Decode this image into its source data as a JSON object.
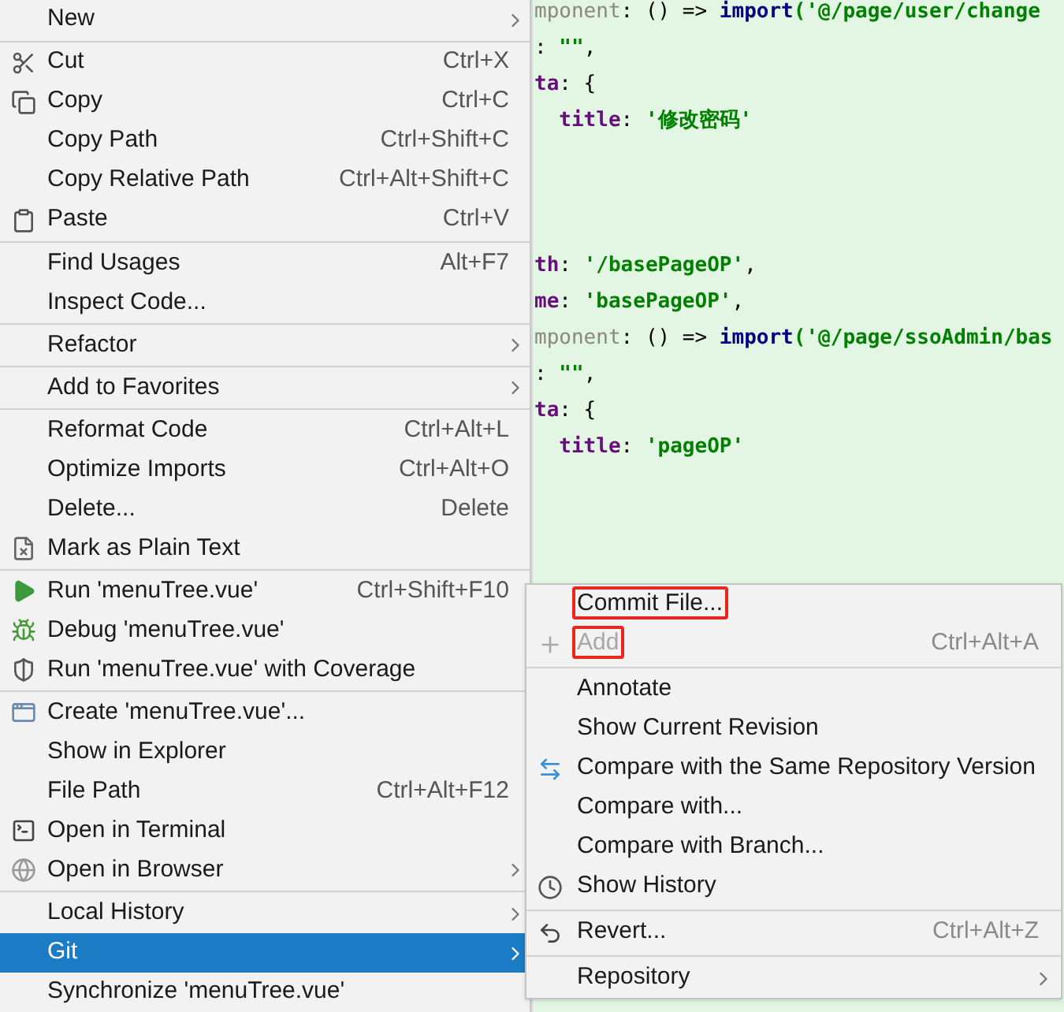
{
  "editor": {
    "code_blocks": [
      {
        "lines": [
          {
            "tokens": [
              {
                "text": "mponent",
                "kind": "dim"
              },
              {
                "text": ": () => ",
                "kind": "plain"
              },
              {
                "text": "import",
                "kind": "keyword"
              },
              {
                "text": "('@/page/user/change",
                "kind": "string"
              }
            ]
          },
          {
            "tokens": [
              {
                "text": ": ",
                "kind": "plain"
              },
              {
                "text": "\"\"",
                "kind": "string"
              },
              {
                "text": ",",
                "kind": "plain"
              }
            ]
          },
          {
            "tokens": [
              {
                "text": "ta",
                "kind": "key"
              },
              {
                "text": ": {",
                "kind": "plain"
              }
            ]
          },
          {
            "tokens": [
              {
                "text": "  title",
                "kind": "key"
              },
              {
                "text": ": ",
                "kind": "plain"
              },
              {
                "text": "'修改密码'",
                "kind": "string"
              }
            ]
          }
        ]
      },
      {
        "lines": [
          {
            "tokens": [
              {
                "text": "th",
                "kind": "key"
              },
              {
                "text": ": ",
                "kind": "plain"
              },
              {
                "text": "'/basePageOP'",
                "kind": "string"
              },
              {
                "text": ",",
                "kind": "plain"
              }
            ]
          },
          {
            "tokens": [
              {
                "text": "me",
                "kind": "key"
              },
              {
                "text": ": ",
                "kind": "plain"
              },
              {
                "text": "'basePageOP'",
                "kind": "string"
              },
              {
                "text": ",",
                "kind": "plain"
              }
            ]
          },
          {
            "tokens": [
              {
                "text": "mponent",
                "kind": "dim"
              },
              {
                "text": ": () => ",
                "kind": "plain"
              },
              {
                "text": "import",
                "kind": "keyword"
              },
              {
                "text": "('@/page/ssoAdmin/bas",
                "kind": "string"
              }
            ]
          },
          {
            "tokens": [
              {
                "text": ": ",
                "kind": "plain"
              },
              {
                "text": "\"\"",
                "kind": "string"
              },
              {
                "text": ",",
                "kind": "plain"
              }
            ]
          },
          {
            "tokens": [
              {
                "text": "ta",
                "kind": "key"
              },
              {
                "text": ": {",
                "kind": "plain"
              }
            ]
          },
          {
            "tokens": [
              {
                "text": "  title",
                "kind": "key"
              },
              {
                "text": ": ",
                "kind": "plain"
              },
              {
                "text": "'pageOP'",
                "kind": "string"
              }
            ]
          }
        ]
      }
    ]
  },
  "context_menu": {
    "items": [
      {
        "kind": "item",
        "label": "New",
        "submenu": true,
        "selected": false
      },
      {
        "kind": "separator"
      },
      {
        "kind": "item",
        "label": "Cut",
        "shortcut": "Ctrl+X",
        "selected": false
      },
      {
        "kind": "item",
        "label": "Copy",
        "shortcut": "Ctrl+C",
        "selected": false
      },
      {
        "kind": "item",
        "label": "Copy Path",
        "shortcut": "Ctrl+Shift+C",
        "selected": false
      },
      {
        "kind": "item",
        "label": "Copy Relative Path",
        "shortcut": "Ctrl+Alt+Shift+C",
        "selected": false
      },
      {
        "kind": "item",
        "label": "Paste",
        "shortcut": "Ctrl+V",
        "selected": false
      },
      {
        "kind": "separator"
      },
      {
        "kind": "item",
        "label": "Find Usages",
        "shortcut": "Alt+F7",
        "selected": false
      },
      {
        "kind": "item",
        "label": "Inspect Code...",
        "selected": false
      },
      {
        "kind": "separator"
      },
      {
        "kind": "item",
        "label": "Refactor",
        "submenu": true,
        "selected": false
      },
      {
        "kind": "separator"
      },
      {
        "kind": "item",
        "label": "Add to Favorites",
        "submenu": true,
        "selected": false
      },
      {
        "kind": "separator"
      },
      {
        "kind": "item",
        "label": "Reformat Code",
        "shortcut": "Ctrl+Alt+L",
        "selected": false
      },
      {
        "kind": "item",
        "label": "Optimize Imports",
        "shortcut": "Ctrl+Alt+O",
        "selected": false
      },
      {
        "kind": "item",
        "label": "Delete...",
        "shortcut": "Delete",
        "selected": false
      },
      {
        "kind": "item",
        "label": "Mark as Plain Text",
        "selected": false
      },
      {
        "kind": "separator"
      },
      {
        "kind": "item",
        "label": "Run 'menuTree.vue'",
        "shortcut": "Ctrl+Shift+F10",
        "selected": false
      },
      {
        "kind": "item",
        "label": "Debug 'menuTree.vue'",
        "selected": false
      },
      {
        "kind": "item",
        "label": "Run 'menuTree.vue' with Coverage",
        "selected": false
      },
      {
        "kind": "separator"
      },
      {
        "kind": "item",
        "label": "Create 'menuTree.vue'...",
        "selected": false
      },
      {
        "kind": "item",
        "label": "Show in Explorer",
        "selected": false
      },
      {
        "kind": "item",
        "label": "File Path",
        "shortcut": "Ctrl+Alt+F12",
        "selected": false
      },
      {
        "kind": "item",
        "label": "Open in Terminal",
        "selected": false
      },
      {
        "kind": "item",
        "label": "Open in Browser",
        "submenu": true,
        "selected": false
      },
      {
        "kind": "separator"
      },
      {
        "kind": "item",
        "label": "Local History",
        "submenu": true,
        "selected": false
      },
      {
        "kind": "item",
        "label": "Git",
        "submenu": true,
        "selected": true
      },
      {
        "kind": "item",
        "label": "Synchronize 'menuTree.vue'",
        "selected": false
      }
    ]
  },
  "git_submenu": {
    "items": [
      {
        "kind": "item",
        "label": "Commit File...",
        "highlighted": true,
        "disabled": false
      },
      {
        "kind": "item",
        "label": "Add",
        "shortcut": "Ctrl+Alt+A",
        "highlighted": true,
        "disabled": true
      },
      {
        "kind": "separator"
      },
      {
        "kind": "item",
        "label": "Annotate",
        "highlighted": false,
        "disabled": false
      },
      {
        "kind": "item",
        "label": "Show Current Revision",
        "highlighted": false,
        "disabled": false
      },
      {
        "kind": "item",
        "label": "Compare with the Same Repository Version",
        "highlighted": false,
        "disabled": false
      },
      {
        "kind": "item",
        "label": "Compare with...",
        "highlighted": false,
        "disabled": false
      },
      {
        "kind": "item",
        "label": "Compare with Branch...",
        "highlighted": false,
        "disabled": false
      },
      {
        "kind": "item",
        "label": "Show History",
        "highlighted": false,
        "disabled": false
      },
      {
        "kind": "separator"
      },
      {
        "kind": "item",
        "label": "Revert...",
        "shortcut": "Ctrl+Alt+Z",
        "highlighted": false,
        "disabled": false
      },
      {
        "kind": "separator"
      },
      {
        "kind": "item",
        "label": "Repository",
        "submenu": true,
        "highlighted": false,
        "disabled": false
      }
    ]
  }
}
